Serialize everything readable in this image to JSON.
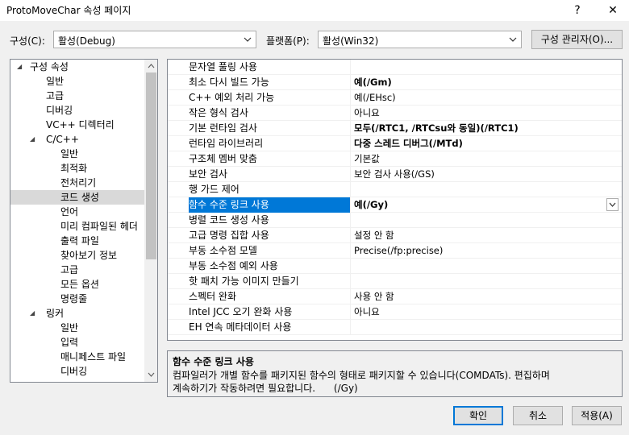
{
  "window": {
    "title": "ProtoMoveChar 속성 페이지",
    "help": "?",
    "close": "✕"
  },
  "config": {
    "config_label": "구성(C):",
    "config_value": "활성(Debug)",
    "platform_label": "플랫폼(P):",
    "platform_value": "활성(Win32)",
    "manager_button": "구성 관리자(O)..."
  },
  "tree": {
    "items": [
      {
        "label": "구성 속성",
        "expanded": true
      },
      {
        "label": "일반"
      },
      {
        "label": "고급"
      },
      {
        "label": "디버깅"
      },
      {
        "label": "VC++ 디렉터리"
      },
      {
        "label": "C/C++",
        "expanded": true
      },
      {
        "label": "일반"
      },
      {
        "label": "최적화"
      },
      {
        "label": "전처리기"
      },
      {
        "label": "코드 생성",
        "selected": true
      },
      {
        "label": "언어"
      },
      {
        "label": "미리 컴파일된 헤더"
      },
      {
        "label": "출력 파일"
      },
      {
        "label": "찾아보기 정보"
      },
      {
        "label": "고급"
      },
      {
        "label": "모든 옵션"
      },
      {
        "label": "명령줄"
      },
      {
        "label": "링커",
        "expanded": true
      },
      {
        "label": "일반"
      },
      {
        "label": "입력"
      },
      {
        "label": "매니페스트 파일"
      },
      {
        "label": "디버깅"
      }
    ]
  },
  "properties": [
    {
      "name": "문자열 풀링 사용",
      "value": ""
    },
    {
      "name": "최소 다시 빌드 가능",
      "value": "예(/Gm)",
      "bold": true
    },
    {
      "name": "C++ 예외 처리 가능",
      "value": "예(/EHsc)"
    },
    {
      "name": "작은 형식 검사",
      "value": "아니요"
    },
    {
      "name": "기본 런타임 검사",
      "value": "모두(/RTC1, /RTCsu와 동일)(/RTC1)",
      "bold": true
    },
    {
      "name": "런타임 라이브러리",
      "value": "다중 스레드 디버그(/MTd)",
      "bold": true
    },
    {
      "name": "구조체 멤버 맞춤",
      "value": "기본값"
    },
    {
      "name": "보안 검사",
      "value": "보안 검사 사용(/GS)"
    },
    {
      "name": "행 가드 제어",
      "value": ""
    },
    {
      "name": "함수 수준 링크 사용",
      "value": "예(/Gy)",
      "selected": true
    },
    {
      "name": "병렬 코드 생성 사용",
      "value": ""
    },
    {
      "name": "고급 명령 집합 사용",
      "value": "설정 안 함"
    },
    {
      "name": "부동 소수점 모델",
      "value": "Precise(/fp:precise)"
    },
    {
      "name": "부동 소수점 예외 사용",
      "value": ""
    },
    {
      "name": "핫 패치 가능 이미지 만들기",
      "value": ""
    },
    {
      "name": "스펙터 완화",
      "value": "사용 안 함"
    },
    {
      "name": "Intel JCC 오기 완화 사용",
      "value": "아니요"
    },
    {
      "name": "EH 연속 메타데이터 사용",
      "value": ""
    }
  ],
  "description": {
    "title": "함수 수준 링크 사용",
    "line1": "컴파일러가 개별 함수를 패키지된 함수의 형태로 패키지할 수 있습니다(COMDATs). 편집하며",
    "line2": "계속하기가 작동하려면 필요합니다.      (/Gy)"
  },
  "buttons": {
    "ok": "확인",
    "cancel": "취소",
    "apply": "적용(A)"
  },
  "colors": {
    "selection": "#0078d7",
    "tree_selection": "#d9d9d9"
  }
}
